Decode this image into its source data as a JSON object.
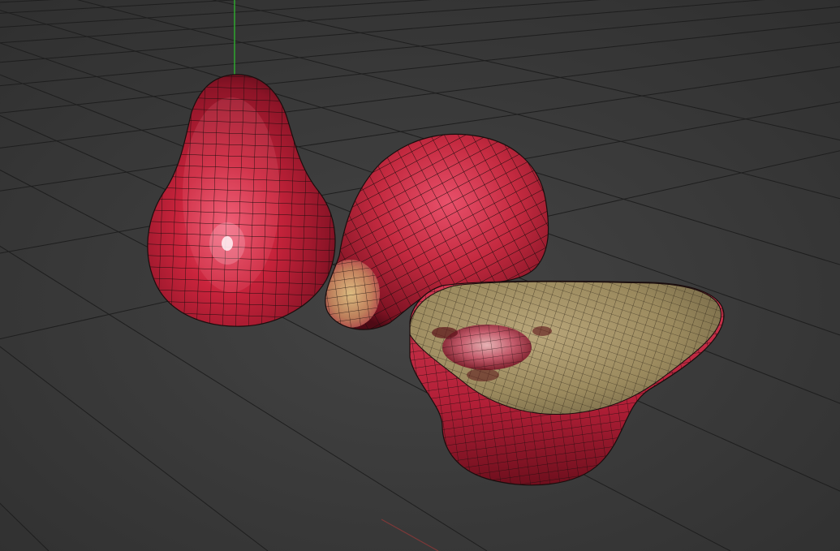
{
  "viewport": {
    "background_color": "#3a3a3a",
    "grid_color": "#1e1e1e",
    "y_axis_color": "#2fae2f",
    "x_axis_color": "#9a3838"
  },
  "objects": [
    {
      "kind": "whole-fruit-upright",
      "skin_color": "#c0283f",
      "highlight_color": "#f2a6b6"
    },
    {
      "kind": "whole-fruit-lying",
      "skin_color": "#c0283f",
      "end_color": "#d9b87a"
    },
    {
      "kind": "halved-fruit",
      "skin_color": "#bd2a41",
      "flesh_color": "#a8946a",
      "seed_cavity_color": "#b73a4d"
    }
  ],
  "wireframe": {
    "color": "#1a0d0d",
    "visible": true
  }
}
